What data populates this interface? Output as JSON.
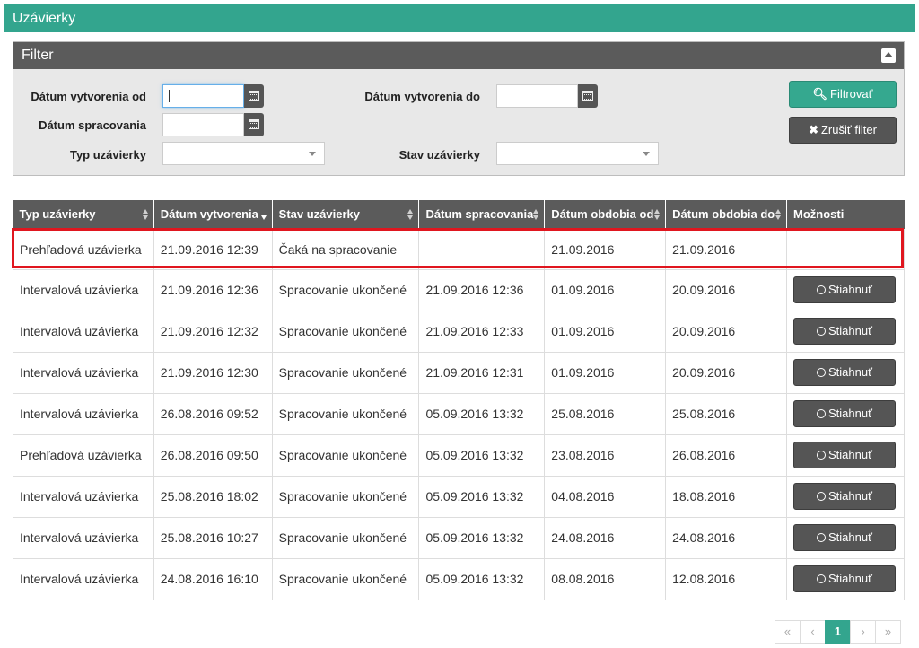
{
  "panel": {
    "title": "Uzávierky"
  },
  "filter": {
    "title": "Filter",
    "created_from_label": "Dátum vytvorenia od",
    "created_to_label": "Dátum vytvorenia do",
    "processed_label": "Dátum spracovania",
    "type_label": "Typ uzávierky",
    "state_label": "Stav uzávierky",
    "created_from_value": "",
    "created_to_value": "",
    "processed_value": "",
    "type_value": "",
    "state_value": "",
    "filter_button": "Filtrovať",
    "clear_button": "Zrušiť filter"
  },
  "table": {
    "columns": [
      "Typ uzávierky",
      "Dátum vytvorenia",
      "Stav uzávierky",
      "Dátum spracovania",
      "Dátum obdobia od",
      "Dátum obdobia do",
      "Možnosti"
    ],
    "download_label": "Stiahnuť",
    "rows": [
      [
        "Prehľadová uzávierka",
        "21.09.2016 12:39",
        "Čaká na spracovanie",
        "",
        "21.09.2016",
        "21.09.2016"
      ],
      [
        "Intervalová uzávierka",
        "21.09.2016 12:36",
        "Spracovanie ukončené",
        "21.09.2016 12:36",
        "01.09.2016",
        "20.09.2016"
      ],
      [
        "Intervalová uzávierka",
        "21.09.2016 12:32",
        "Spracovanie ukončené",
        "21.09.2016 12:33",
        "01.09.2016",
        "20.09.2016"
      ],
      [
        "Intervalová uzávierka",
        "21.09.2016 12:30",
        "Spracovanie ukončené",
        "21.09.2016 12:31",
        "01.09.2016",
        "20.09.2016"
      ],
      [
        "Intervalová uzávierka",
        "26.08.2016 09:52",
        "Spracovanie ukončené",
        "05.09.2016 13:32",
        "25.08.2016",
        "25.08.2016"
      ],
      [
        "Prehľadová uzávierka",
        "26.08.2016 09:50",
        "Spracovanie ukončené",
        "05.09.2016 13:32",
        "23.08.2016",
        "26.08.2016"
      ],
      [
        "Intervalová uzávierka",
        "25.08.2016 18:02",
        "Spracovanie ukončené",
        "05.09.2016 13:32",
        "04.08.2016",
        "18.08.2016"
      ],
      [
        "Intervalová uzávierka",
        "25.08.2016 10:27",
        "Spracovanie ukončené",
        "05.09.2016 13:32",
        "24.08.2016",
        "24.08.2016"
      ],
      [
        "Intervalová uzávierka",
        "24.08.2016 16:10",
        "Spracovanie ukončené",
        "05.09.2016 13:32",
        "08.08.2016",
        "12.08.2016"
      ]
    ]
  },
  "pagination": {
    "first": "«",
    "prev": "‹",
    "current": "1",
    "next": "›",
    "last": "»"
  },
  "colors": {
    "accent": "#33a58e",
    "dark": "#5b5b5b",
    "highlight": "#e0161f"
  }
}
